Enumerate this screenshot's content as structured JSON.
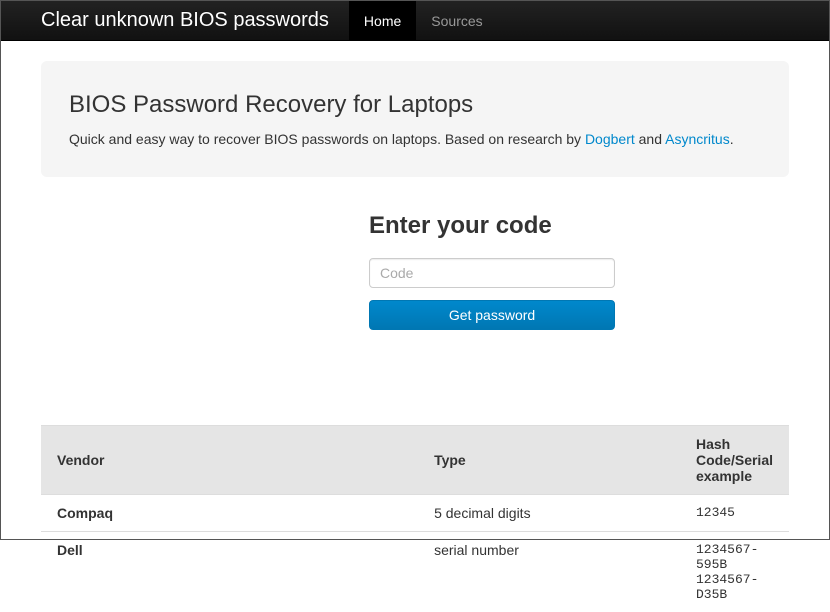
{
  "nav": {
    "brand": "Clear unknown BIOS passwords",
    "items": [
      {
        "label": "Home",
        "active": true
      },
      {
        "label": "Sources",
        "active": false
      }
    ]
  },
  "hero": {
    "title": "BIOS Password Recovery for Laptops",
    "lead_prefix": "Quick and easy way to recover BIOS passwords on laptops. Based on research by ",
    "link1": "Dogbert",
    "lead_mid": " and ",
    "link2": "Asyncritus",
    "lead_suffix": "."
  },
  "form": {
    "heading": "Enter your code",
    "placeholder": "Code",
    "button": "Get password"
  },
  "table": {
    "headers": [
      "Vendor",
      "Type",
      "Hash Code/Serial example"
    ],
    "rows": [
      {
        "vendor": "Compaq",
        "type": "5 decimal digits",
        "example": "12345"
      },
      {
        "vendor": "Dell",
        "type": "serial number",
        "example": "1234567-595B\n1234567-D35B"
      }
    ]
  }
}
